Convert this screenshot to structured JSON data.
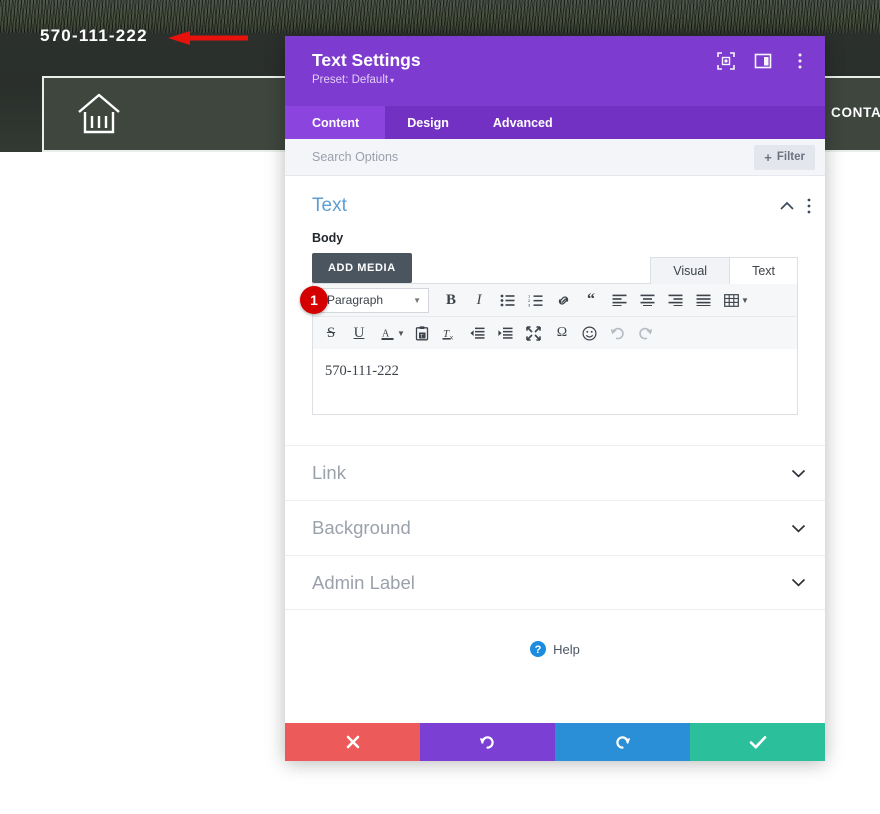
{
  "background_site": {
    "phone": "570-111-222",
    "contact_label": "CONTA",
    "logo_icon": "bank-house-icon",
    "arrow_icon": "red-left-arrow-annotation"
  },
  "modal": {
    "title": "Text Settings",
    "preset_label": "Preset: Default",
    "preset_caret": "▾",
    "header_icons": [
      {
        "name": "focus-target-icon"
      },
      {
        "name": "layout-panel-icon"
      },
      {
        "name": "more-options-icon"
      }
    ],
    "tabs": [
      {
        "label": "Content",
        "active": true
      },
      {
        "label": "Design",
        "active": false
      },
      {
        "label": "Advanced",
        "active": false
      }
    ],
    "search": {
      "placeholder": "Search Options",
      "filter_label": "Filter",
      "filter_plus": "+"
    },
    "section": {
      "title": "Text",
      "collapse_icon": "chevron-up-icon",
      "menu_icon": "more-options-icon"
    },
    "field": {
      "label": "Body",
      "add_media_label": "ADD MEDIA",
      "editor_mode_tabs": [
        {
          "label": "Visual",
          "active": true
        },
        {
          "label": "Text",
          "active": false
        }
      ],
      "format_select": "Paragraph",
      "toolbar_row1": [
        "bold-icon",
        "italic-icon",
        "bulleted-list-icon",
        "numbered-list-icon",
        "link-icon",
        "blockquote-icon",
        "align-left-icon",
        "align-center-icon",
        "align-right-icon",
        "align-justify-icon",
        "table-icon"
      ],
      "toolbar_row2": [
        "strikethrough-icon",
        "underline-icon",
        "text-color-icon",
        "paste-as-text-icon",
        "clear-formatting-icon",
        "decrease-indent-icon",
        "increase-indent-icon",
        "fullscreen-icon",
        "special-character-icon",
        "emoji-icon",
        "undo-icon",
        "redo-icon"
      ],
      "content": "570-111-222"
    },
    "annotation_badge": "1",
    "accordions": [
      {
        "label": "Link"
      },
      {
        "label": "Background"
      },
      {
        "label": "Admin Label"
      }
    ],
    "help_label": "Help",
    "footer_buttons": [
      {
        "name": "cancel-button",
        "icon": "close-x-icon",
        "color": "#ed5a5a"
      },
      {
        "name": "undo-button",
        "icon": "undo-arrow-icon",
        "color": "#7b3fd4"
      },
      {
        "name": "redo-button",
        "icon": "redo-arrow-icon",
        "color": "#2a8fd6"
      },
      {
        "name": "save-button",
        "icon": "checkmark-icon",
        "color": "#2bbf9b"
      }
    ]
  },
  "colors": {
    "modal_header": "#7e3bd0",
    "tabbar": "#7331c4",
    "tab_active": "#8b45de",
    "section_title": "#5f9ed1",
    "badge": "#d40000",
    "site_dark": "#2b302c"
  }
}
